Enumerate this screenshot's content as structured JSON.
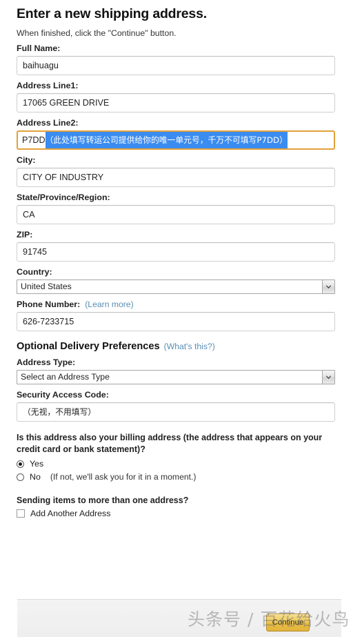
{
  "header": {
    "title": "Enter a new shipping address.",
    "subtitle": "When finished, click the \"Continue\" button."
  },
  "form": {
    "full_name": {
      "label": "Full Name:",
      "value": "baihuagu"
    },
    "address_line1": {
      "label": "Address Line1:",
      "value": "17065 GREEN DRIVE"
    },
    "address_line2": {
      "label": "Address Line2:",
      "value_plain": "P7DD",
      "value_selected": "（此处填写转运公司提供给你的唯一单元号，千万不可填写P7DD）",
      "focused": true,
      "focus_border_color": "#e3a03a",
      "selection_color": "#3b8cf0"
    },
    "city": {
      "label": "City:",
      "value": "CITY OF INDUSTRY"
    },
    "state": {
      "label": "State/Province/Region:",
      "value": "CA"
    },
    "zip": {
      "label": "ZIP:",
      "value": "91745"
    },
    "country": {
      "label": "Country:",
      "value": "United States"
    },
    "phone": {
      "label": "Phone Number:",
      "learn_more": "(Learn more)",
      "value": "626-7233715"
    }
  },
  "optional_section": {
    "title": "Optional Delivery Preferences",
    "whats_this": "(What's this?)",
    "address_type": {
      "label": "Address Type:",
      "value": "Select an Address Type"
    },
    "security_access_code": {
      "label": "Security Access Code:",
      "value": "（无视，不用填写）"
    }
  },
  "billing": {
    "question": "Is this address also your billing address (the address that appears on your credit card or bank statement)?",
    "options": [
      {
        "label": "Yes",
        "note": "",
        "checked": true
      },
      {
        "label": "No",
        "note": "(If not, we'll ask you for it in a moment.)",
        "checked": false
      }
    ]
  },
  "multi_address": {
    "question": "Sending items to more than one address?",
    "checkbox_label": "Add Another Address",
    "checked": false
  },
  "footer": {
    "continue_label": "Continue",
    "continue_color": "#e8bd45"
  },
  "watermark": {
    "text": "头条号 / 百花给火鸟"
  }
}
